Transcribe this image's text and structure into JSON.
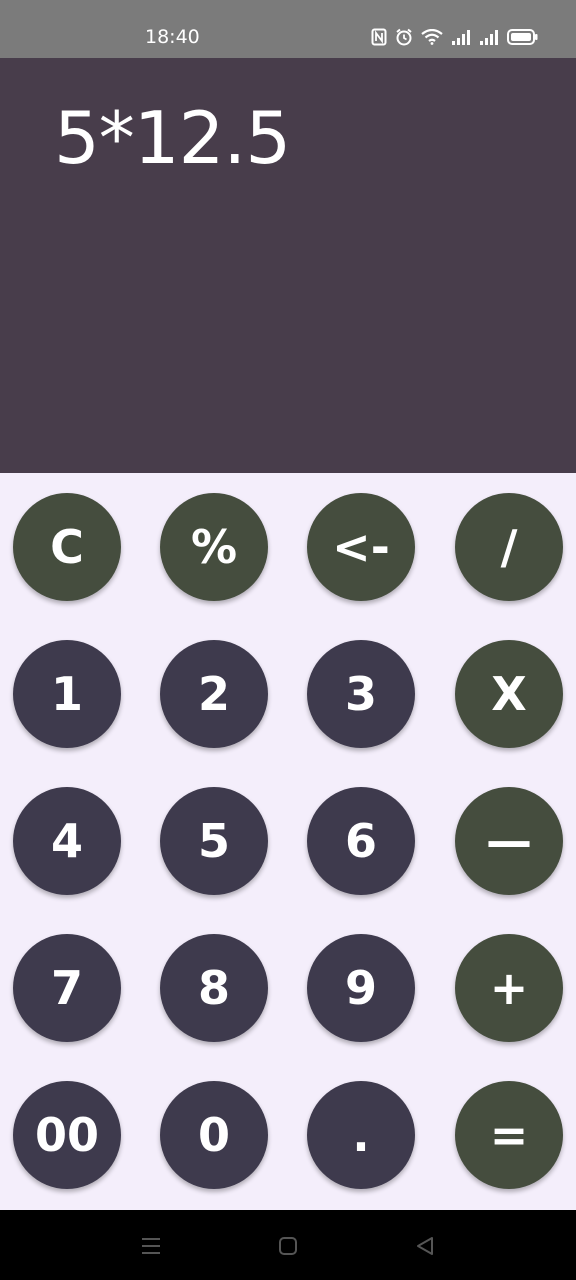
{
  "status_bar": {
    "time": "18:40",
    "icons": [
      "nfc-icon",
      "alarm-icon",
      "wifi-icon",
      "signal-icon",
      "signal-icon",
      "battery-icon"
    ]
  },
  "display": {
    "expression": "5*12.5"
  },
  "keypad": {
    "rows": [
      [
        {
          "label": "C",
          "kind": "op"
        },
        {
          "label": "%",
          "kind": "op"
        },
        {
          "label": "<-",
          "kind": "op"
        },
        {
          "label": "/",
          "kind": "op"
        }
      ],
      [
        {
          "label": "1",
          "kind": "num"
        },
        {
          "label": "2",
          "kind": "num"
        },
        {
          "label": "3",
          "kind": "num"
        },
        {
          "label": "X",
          "kind": "op"
        }
      ],
      [
        {
          "label": "4",
          "kind": "num"
        },
        {
          "label": "5",
          "kind": "num"
        },
        {
          "label": "6",
          "kind": "num"
        },
        {
          "label": "—",
          "kind": "op"
        }
      ],
      [
        {
          "label": "7",
          "kind": "num"
        },
        {
          "label": "8",
          "kind": "num"
        },
        {
          "label": "9",
          "kind": "num"
        },
        {
          "label": "+",
          "kind": "op"
        }
      ],
      [
        {
          "label": "00",
          "kind": "num"
        },
        {
          "label": "0",
          "kind": "num"
        },
        {
          "label": ".",
          "kind": "num"
        },
        {
          "label": "=",
          "kind": "op"
        }
      ]
    ]
  },
  "colors": {
    "display_bg": "#483d4b",
    "number_key": "#3e3a4d",
    "operator_key": "#454d3e",
    "keypad_bg": "#f4eefb"
  },
  "nav_bar": {
    "icons": [
      "menu-icon",
      "home-icon",
      "back-icon"
    ]
  }
}
